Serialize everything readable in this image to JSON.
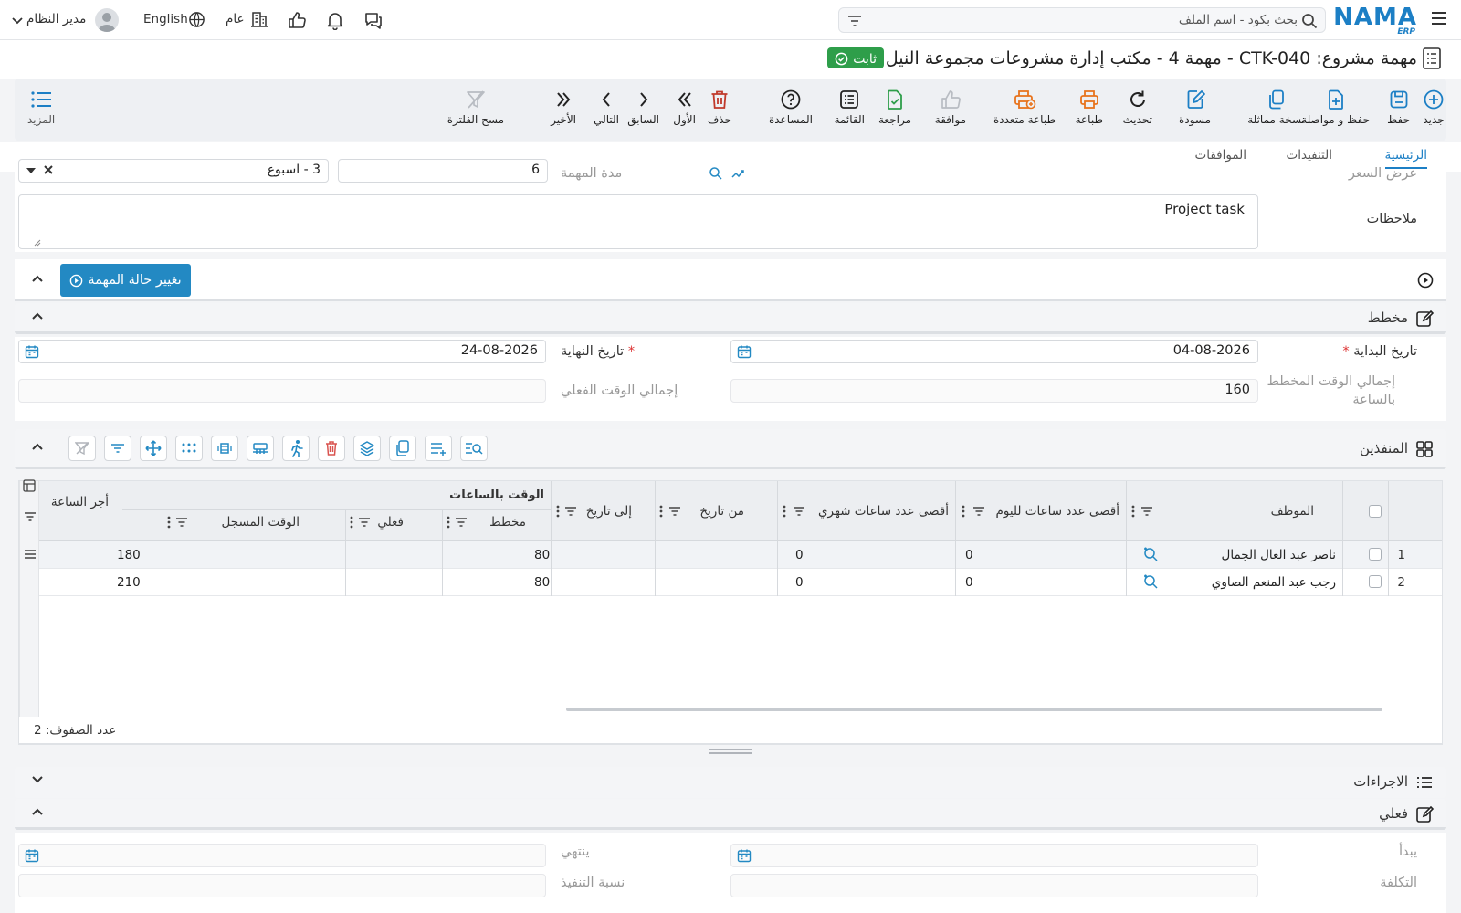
{
  "topbar": {
    "search_placeholder": "بحث بكود - اسم الملف",
    "language": "English",
    "branch": "عام",
    "user": "مدير النظام",
    "logo_text": "NAMA",
    "logo_sub": "ERP"
  },
  "title": {
    "text": "مهمة مشروع: CTK-040 - مهمة 4 - مكتب إدارة مشروعات مجموعة النيل",
    "status": "ثابت"
  },
  "toolbar": {
    "buttons": [
      {
        "label": "جديد",
        "icon": "plus-circle-icon",
        "color": "#1c7fc5"
      },
      {
        "label": "حفظ",
        "icon": "save-icon",
        "color": "#1c7fc5"
      },
      {
        "label": "حفظ و مواصلة",
        "icon": "file-plus-icon",
        "color": "#1c7fc5"
      },
      {
        "label": "نسخة مماثلة",
        "icon": "copy-icon",
        "color": "#1c7fc5"
      },
      {
        "label": "مسودة",
        "icon": "edit-icon",
        "color": "#1c7fc5"
      },
      {
        "label": "تحديث",
        "icon": "refresh-icon",
        "color": "#222222"
      },
      {
        "label": "طباعة",
        "icon": "printer-icon",
        "color": "#e8731c"
      },
      {
        "label": "طباعة متعددة",
        "icon": "multi-print-icon",
        "color": "#e8731c"
      },
      {
        "label": "موافقة",
        "icon": "thumbs-up-icon",
        "color": "#b8bcc2"
      },
      {
        "label": "مراجعة",
        "icon": "review-icon",
        "color": "#2e9e4a"
      },
      {
        "label": "القائمة",
        "icon": "list-icon",
        "color": "#222222"
      },
      {
        "label": "المساعدة",
        "icon": "help-icon",
        "color": "#222222"
      },
      {
        "label": "حذف",
        "icon": "trash-icon",
        "color": "#c0392b"
      },
      {
        "label": "الأول",
        "icon": "first-icon",
        "color": "#222222"
      },
      {
        "label": "السابق",
        "icon": "prev-icon",
        "color": "#222222"
      },
      {
        "label": "التالي",
        "icon": "next-icon",
        "color": "#222222"
      },
      {
        "label": "الأخير",
        "icon": "last-icon",
        "color": "#222222"
      },
      {
        "label": "مسح الفلترة",
        "icon": "clear-filter-icon",
        "color": "#b8bcc2"
      }
    ],
    "more_label": "المزيد"
  },
  "tabs": [
    "الرئيسية",
    "التنفيذات",
    "الموافقات"
  ],
  "form": {
    "price_offer_label": "عرض السعر",
    "duration_label": "مدة المهمة",
    "duration_value": "6",
    "duration_unit": "3 - اسبوع",
    "notes_label": "ملاحظات",
    "notes_value": "Project task"
  },
  "change_status_button": "تغيير حالة المهمة",
  "plan_section": {
    "title": "مخطط",
    "start_label": "تاريخ البداية",
    "start_value": "04-08-2026",
    "end_label": "تاريخ النهاية",
    "end_value": "24-08-2026",
    "planned_total_label": "إجمالي الوقت المخطط بالساعة",
    "planned_total_value": "160",
    "actual_total_label": "إجمالي الوقت الفعلي",
    "actual_total_value": ""
  },
  "executors_section": {
    "title": "المنفذين",
    "columns": {
      "employee": "الموظف",
      "max_daily": "أقصى عدد ساعات لليوم",
      "max_monthly": "أقصى عدد ساعات شهري",
      "from_date": "من تاريخ",
      "to_date": "إلى تاريخ",
      "hours_group": "الوقت بالساعات",
      "planned": "مخطط",
      "actual": "فعلي",
      "logged": "الوقت المسجل",
      "hour_rate": "أجر الساعة"
    },
    "rows": [
      {
        "num": "1",
        "employee": "ناصر عبد العال الجمال",
        "max_daily": "0",
        "max_monthly": "0",
        "from": "",
        "to": "",
        "planned": "80",
        "actual": "",
        "logged": "",
        "rate": "180"
      },
      {
        "num": "2",
        "employee": "رجب عبد المنعم الصاوي",
        "max_daily": "0",
        "max_monthly": "0",
        "from": "",
        "to": "",
        "planned": "80",
        "actual": "",
        "logged": "",
        "rate": "210"
      }
    ],
    "row_count_label": "عدد الصفوف: 2"
  },
  "procedures_section": {
    "title": "الاجراءات"
  },
  "actual_section": {
    "title": "فعلي",
    "start_label": "يبدأ",
    "end_label": "ينتهي",
    "cost_label": "التكلفة",
    "progress_label": "نسبة التنفيذ"
  }
}
